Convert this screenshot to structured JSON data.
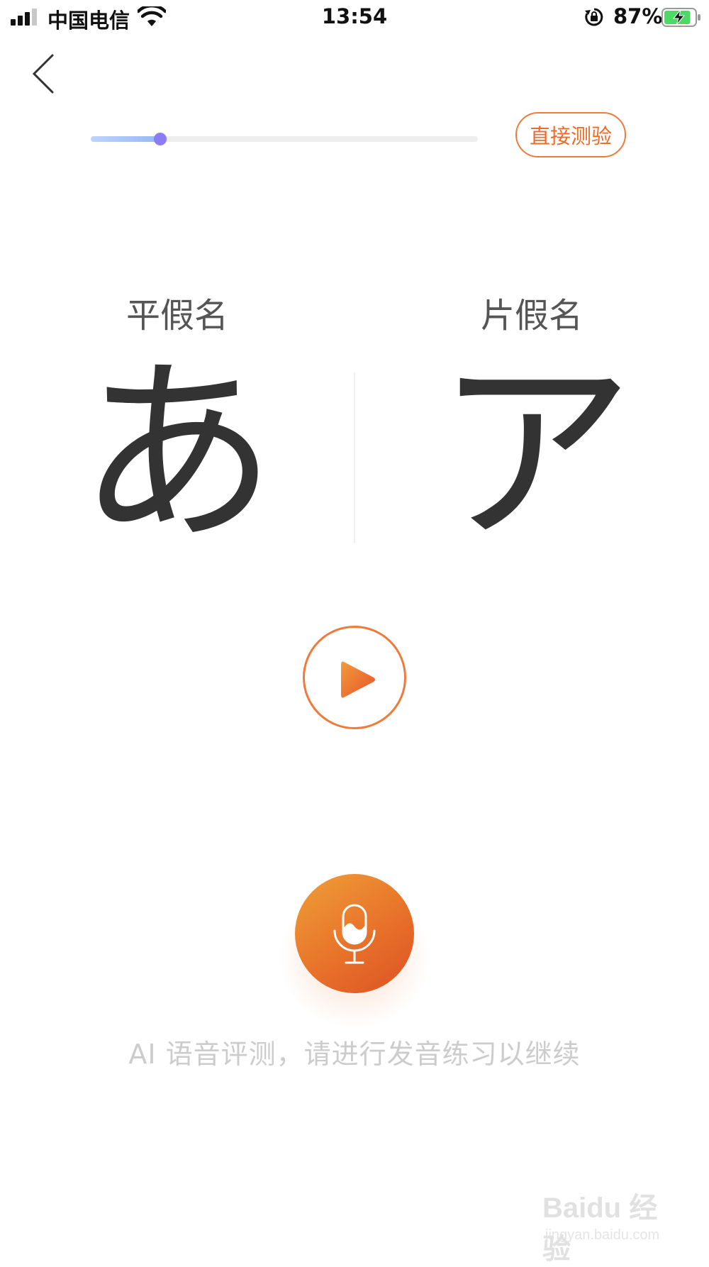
{
  "status_bar": {
    "carrier": "中国电信",
    "time": "13:54",
    "battery_percent": "87%",
    "battery_level": 0.87,
    "icons": [
      "signal-icon",
      "wifi-icon",
      "orientation-lock-icon",
      "battery-charging-icon"
    ]
  },
  "nav": {
    "back_icon": "chevron-left-icon"
  },
  "progress": {
    "value": 0.18
  },
  "test_button": {
    "label": "直接测验"
  },
  "kana": {
    "hiragana_label": "平假名",
    "hiragana_char": "あ",
    "katakana_label": "片假名",
    "katakana_char": "ア"
  },
  "play_button": {
    "icon": "play-icon"
  },
  "mic_button": {
    "icon": "microphone-icon"
  },
  "hint": {
    "text": "AI 语音评测，请进行发音练习以继续"
  },
  "watermark": {
    "brand": "Baidu 经验",
    "url": "jingyan.baidu.com"
  },
  "colors": {
    "accent": "#ee6a26",
    "progress_fill": "#97b8f7",
    "progress_thumb": "#8b7bf4",
    "text_dark": "#333333",
    "hint": "#cccccc"
  }
}
